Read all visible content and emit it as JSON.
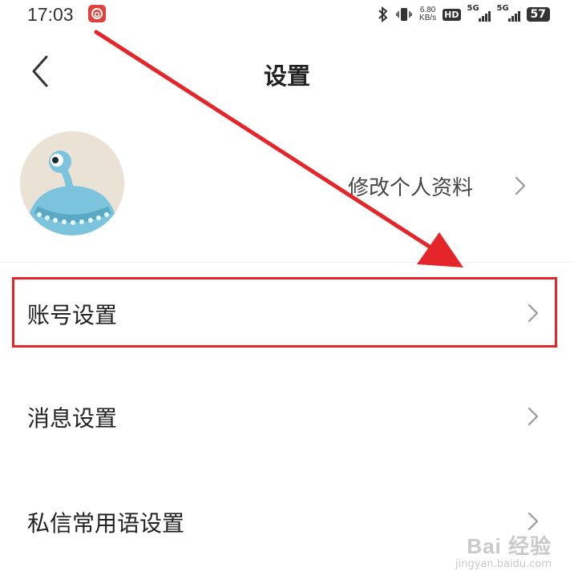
{
  "status_bar": {
    "time": "17:03",
    "app_icon": "netease-music-icon",
    "bluetooth_icon": "bluetooth-icon",
    "vibrate_icon": "vibrate-icon",
    "net_speed_value": "6.80",
    "net_speed_unit": "KB/s",
    "hd_label": "HD",
    "sim1_label": "5G",
    "sim2_label": "5G",
    "battery": "57"
  },
  "header": {
    "title": "设置",
    "back_icon": "chevron-left-icon"
  },
  "profile": {
    "edit_label": "修改个人资料",
    "avatar_icon": "monster-avatar"
  },
  "menu": {
    "items": [
      {
        "label": "账号设置"
      },
      {
        "label": "消息设置"
      },
      {
        "label": "私信常用语设置"
      }
    ]
  },
  "annotation": {
    "color": "#e4262a",
    "arrow_icon": "red-arrow-annotation"
  },
  "watermark": {
    "main": "Bai 经验",
    "sub": "jingyan.baidu.com"
  }
}
